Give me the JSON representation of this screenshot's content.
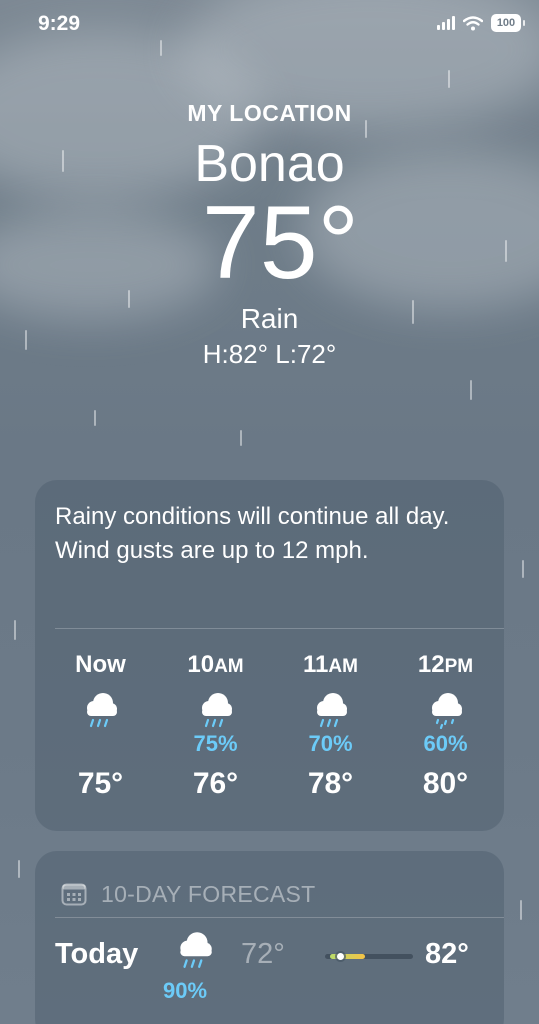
{
  "status_bar": {
    "time": "9:29",
    "battery": "100"
  },
  "location": {
    "label": "MY LOCATION",
    "city": "Bonao",
    "temperature": "75°",
    "condition": "Rain",
    "high_low": "H:82°  L:72°"
  },
  "summary": {
    "text": "Rainy conditions will continue all day. Wind gusts are up to 12 mph."
  },
  "hourly": [
    {
      "hour": "Now",
      "suffix": "",
      "icon": "rain-cloud-icon",
      "precip": "",
      "temp": "75°"
    },
    {
      "hour": "10",
      "suffix": "AM",
      "icon": "rain-cloud-icon",
      "precip": "75%",
      "temp": "76°"
    },
    {
      "hour": "11",
      "suffix": "AM",
      "icon": "rain-cloud-icon",
      "precip": "70%",
      "temp": "78°"
    },
    {
      "hour": "12",
      "suffix": "PM",
      "icon": "drizzle-cloud-icon",
      "precip": "60%",
      "temp": "80°"
    }
  ],
  "forecast": {
    "header": "10-DAY FORECAST",
    "icon": "calendar-icon",
    "days": [
      {
        "day": "Today",
        "icon": "rain-cloud-icon",
        "precip": "90%",
        "low": "72°",
        "high": "82°"
      }
    ]
  },
  "colors": {
    "accent_precip": "#6ccbf8",
    "range_start": "#b9dc6a",
    "range_end": "#f5c346"
  }
}
